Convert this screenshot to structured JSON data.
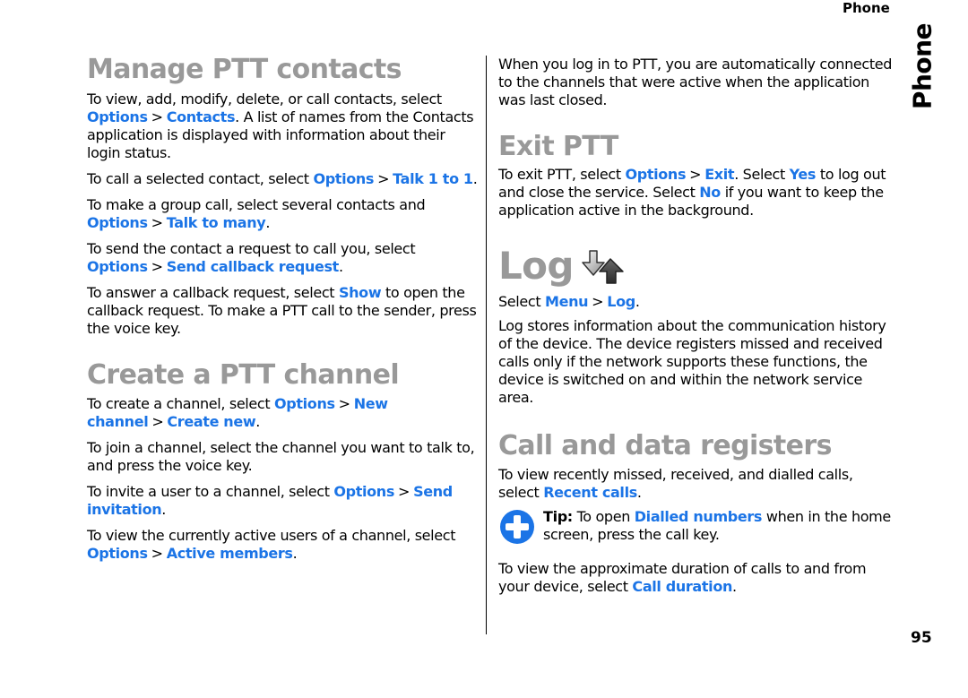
{
  "header": {
    "running_title": "Phone",
    "side_tab": "Phone"
  },
  "page_number": "95",
  "colors": {
    "heading": "#999999",
    "link": "#1b74e6",
    "tip_icon": "#1b74e6",
    "text": "#000000"
  },
  "left": {
    "manage": {
      "heading": "Manage PTT contacts",
      "p1": {
        "t1": "To view, add, modify, delete, or call contacts, select ",
        "l1": "Options",
        "sep": ">",
        "l2": "Contacts",
        "t2": ". A list of names from the Contacts application is displayed with information about their login status."
      },
      "p2": {
        "t1": "To call a selected contact, select ",
        "l1": "Options",
        "sep": ">",
        "l2": "Talk 1 to 1",
        "t2": "."
      },
      "p3": {
        "t1": "To make a group call, select several contacts and ",
        "l1": "Options",
        "sep": ">",
        "l2": "Talk to many",
        "t2": "."
      },
      "p4": {
        "t1": "To send the contact a request to call you, select ",
        "l1": "Options",
        "sep": ">",
        "l2": "Send callback request",
        "t2": "."
      },
      "p5": {
        "t1": "To answer a callback request, select ",
        "l1": "Show",
        "t2": " to open the callback request. To make a PTT call to the sender, press the voice key."
      }
    },
    "channel": {
      "heading": "Create a PTT channel",
      "p1": {
        "t1": "To create a channel, select ",
        "l1": "Options",
        "sep": ">",
        "l2": "New channel",
        "sep2": ">",
        "l3": "Create new",
        "t2": "."
      },
      "p2": {
        "t1": "To join a channel, select the channel you want to talk to, and press the voice key."
      },
      "p3": {
        "t1": "To invite a user to a channel, select ",
        "l1": "Options",
        "sep": ">",
        "l2": "Send invitation",
        "t2": "."
      },
      "p4": {
        "t1": "To view the currently active users of a channel, select ",
        "l1": "Options",
        "sep": ">",
        "l2": "Active members",
        "t2": "."
      }
    }
  },
  "right": {
    "intro": "When you log in to PTT, you are automatically connected to the channels that were active when the application was last closed.",
    "exit": {
      "heading": "Exit PTT",
      "p1": {
        "t1": "To exit PTT, select ",
        "l1": "Options",
        "sep": ">",
        "l2": "Exit",
        "t2": ". Select ",
        "l3": "Yes",
        "t3": " to log out and close the service. Select ",
        "l4": "No",
        "t4": " if you want to keep the application active in the background."
      }
    },
    "log": {
      "heading": "Log",
      "icon": "log-arrows-icon",
      "p1": {
        "t1": "Select ",
        "l1": "Menu",
        "sep": ">",
        "l2": "Log",
        "t2": "."
      },
      "p2": "Log stores information about the communication history of the device. The device registers missed and received calls only if the network supports these functions, the device is switched on and within the network service area."
    },
    "registers": {
      "heading": "Call and data registers",
      "p1": {
        "t1": "To view recently missed, received, and dialled calls, select ",
        "l1": "Recent calls",
        "t2": "."
      },
      "tip": {
        "icon": "plus-circle-icon",
        "label": "Tip:",
        "t1": " To open ",
        "l1": "Dialled numbers",
        "t2": " when in the home screen, press the call key."
      },
      "p2": {
        "t1": "To view the approximate duration of calls to and from your device, select ",
        "l1": "Call duration",
        "t2": "."
      }
    }
  }
}
